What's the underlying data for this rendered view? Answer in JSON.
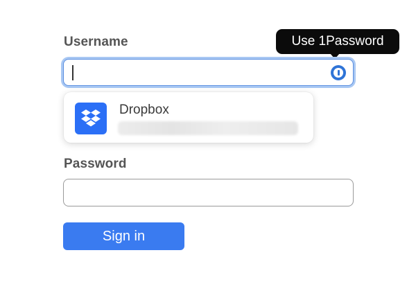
{
  "form": {
    "username_label": "Username",
    "username_value": "",
    "password_label": "Password",
    "password_value": "",
    "signin_label": "Sign in"
  },
  "onepassword": {
    "tooltip": "Use 1Password",
    "icon": "1password-icon"
  },
  "suggestion": {
    "title": "Dropbox",
    "icon": "dropbox-logo-icon"
  },
  "colors": {
    "primary_button": "#3a7bf0",
    "focus_ring": "#a9c8f3",
    "dropbox_blue": "#2b6ff6",
    "tooltip_bg": "#0b0b0b"
  }
}
